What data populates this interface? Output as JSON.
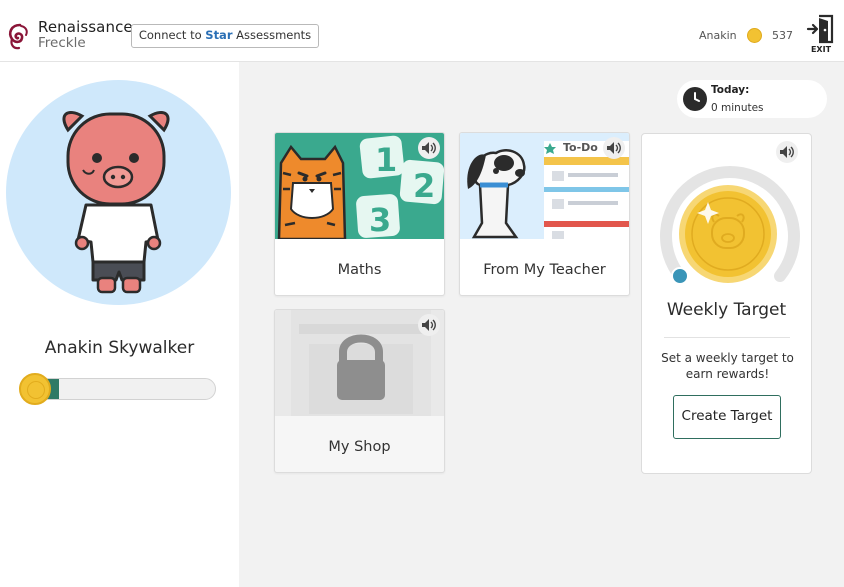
{
  "header": {
    "brand_name": "Renaissance",
    "product_name": "Freckle",
    "connect_prefix": "Connect to",
    "connect_star": "Star",
    "connect_suffix": "Assessments",
    "user_name": "Anakin",
    "coin_count": "537",
    "exit_label": "EXIT"
  },
  "sidebar": {
    "student_name": "Anakin Skywalker",
    "progress_fraction": 0.17
  },
  "today": {
    "label": "Today:",
    "value": "0 minutes"
  },
  "cards": {
    "maths": {
      "label": "Maths"
    },
    "teacher": {
      "label": "From My Teacher",
      "todo_label": "To-Do"
    },
    "shop": {
      "label": "My Shop"
    }
  },
  "weekly_target": {
    "title": "Weekly Target",
    "description": "Set a weekly target to earn rewards!",
    "button_label": "Create Target"
  },
  "colors": {
    "accent_green": "#2f7a66",
    "coin_gold": "#f2c232",
    "avatar_bg": "#cfe8fb",
    "star_blue": "#2a6fb5"
  }
}
